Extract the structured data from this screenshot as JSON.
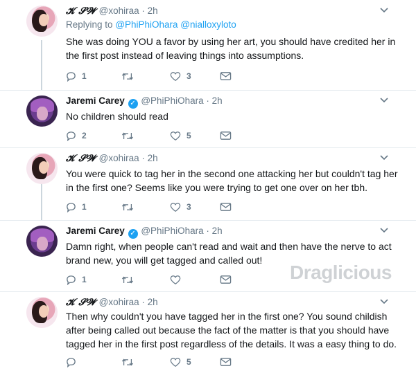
{
  "watermark": "Draglicious",
  "tweets": [
    {
      "name": "𝓚 𝓢𝓦",
      "handle": "@xohiraa",
      "time": "· 2h",
      "verified": false,
      "replying_prefix": "Replying to",
      "replying_to": "@PhiPhiOhara @nialloxyloto",
      "text": "She was doing YOU a favor by using her art, you should have credited her in the first post instead of leaving things into assumptions.",
      "replies": "1",
      "retweets": "",
      "likes": "3"
    },
    {
      "name": "Jaremi Carey",
      "handle": "@PhiPhiOhara",
      "time": "· 2h",
      "verified": true,
      "text": "No children should read",
      "replies": "2",
      "retweets": "",
      "likes": "5"
    },
    {
      "name": "𝓚 𝓢𝓦",
      "handle": "@xohiraa",
      "time": "· 2h",
      "verified": false,
      "text": "You were quick to tag her in the second one attacking her but couldn't tag her in the first one? Seems like you were trying to get one over on her tbh.",
      "replies": "1",
      "retweets": "",
      "likes": "3"
    },
    {
      "name": "Jaremi Carey",
      "handle": "@PhiPhiOhara",
      "time": "· 2h",
      "verified": true,
      "text": "Damn right, when people can't read and wait and then have the nerve to act brand new, you will get tagged and called out!",
      "replies": "1",
      "retweets": "",
      "likes": ""
    },
    {
      "name": "𝓚 𝓢𝓦",
      "handle": "@xohiraa",
      "time": "· 2h",
      "verified": false,
      "text": "Then why couldn't you have tagged her in the first one? You sound childish after being called out because the fact of the matter is that you should have tagged her in the first post regardless of the details. It was a easy thing to do.",
      "replies": "",
      "retweets": "",
      "likes": "5"
    }
  ]
}
